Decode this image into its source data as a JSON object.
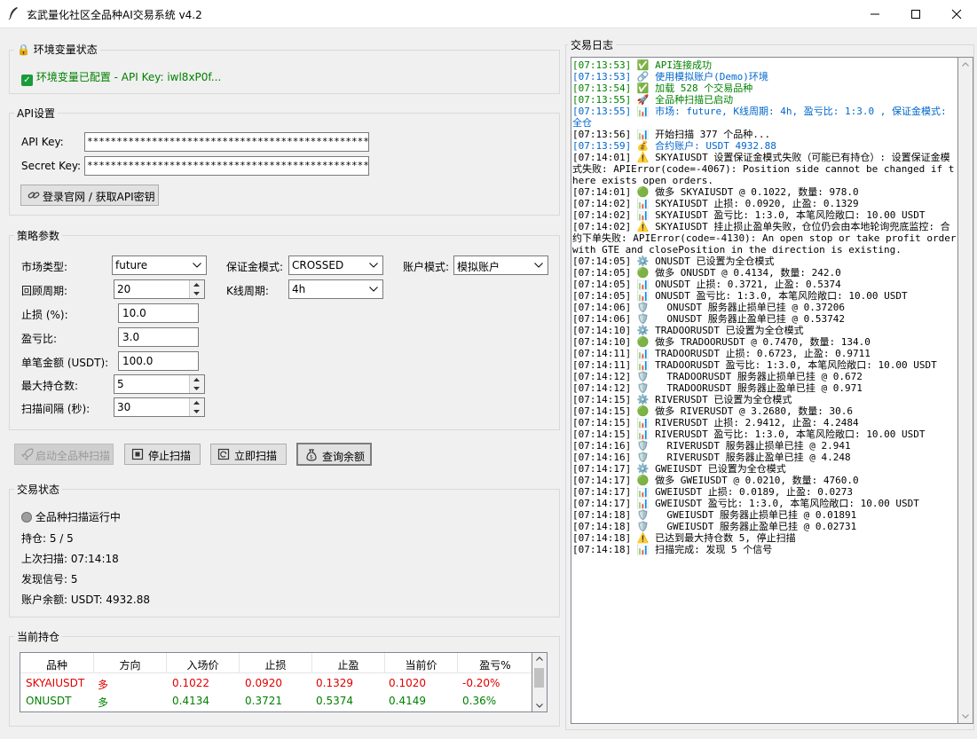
{
  "window": {
    "title": "玄武量化社区全品种AI交易系统 v4.2"
  },
  "env": {
    "group_label": "环境变量状态",
    "status_text": "环境变量已配置 - API Key: iwl8xP0f..."
  },
  "api": {
    "group_label": "API设置",
    "api_key_label": "API Key:",
    "api_key_value": "**************************************************",
    "secret_key_label": "Secret Key:",
    "secret_key_value": "**************************************************",
    "login_button": "登录官网 / 获取API密钥"
  },
  "strategy": {
    "group_label": "策略参数",
    "market_type_label": "市场类型:",
    "market_type_value": "future",
    "margin_mode_label": "保证金模式:",
    "margin_mode_value": "CROSSED",
    "account_mode_label": "账户模式:",
    "account_mode_value": "模拟账户",
    "lookback_label": "回顾周期:",
    "lookback_value": "20",
    "kline_label": "K线周期:",
    "kline_value": "4h",
    "stop_loss_label": "止损 (%):",
    "stop_loss_value": "10.0",
    "rr_label": "盈亏比:",
    "rr_value": "3.0",
    "amount_label": "单笔金额 (USDT):",
    "amount_value": "100.0",
    "max_pos_label": "最大持仓数:",
    "max_pos_value": "5",
    "interval_label": "扫描间隔 (秒):",
    "interval_value": "30"
  },
  "actions": {
    "start": "启动全品种扫描",
    "stop": "停止扫描",
    "scan_now": "立即扫描",
    "balance": "查询余额"
  },
  "status": {
    "group_label": "交易状态",
    "running": "全品种扫描运行中",
    "positions": "持仓: 5 / 5",
    "last_scan": "上次扫描: 07:14:18",
    "signals": "发现信号: 5",
    "balance": "账户余额: USDT: 4932.88"
  },
  "positions_table": {
    "group_label": "当前持仓",
    "headers": [
      "品种",
      "方向",
      "入场价",
      "止损",
      "止盈",
      "当前价",
      "盈亏%"
    ],
    "rows": [
      {
        "cells": [
          "SKYAIUSDT",
          "多",
          "0.1022",
          "0.0920",
          "0.1329",
          "0.1020",
          "-0.20%"
        ],
        "color": "#e00000"
      },
      {
        "cells": [
          "ONUSDT",
          "多",
          "0.4134",
          "0.3721",
          "0.5374",
          "0.4149",
          "0.36%"
        ],
        "color": "#008000"
      }
    ]
  },
  "log": {
    "group_label": "交易日志",
    "lines": [
      {
        "text": "[07:13:53] ✅ API连接成功",
        "style": "gn"
      },
      {
        "text": "[07:13:53] 🔗 使用模拟账户(Demo)环境",
        "style": "bl"
      },
      {
        "text": "[07:13:54] ✅ 加载 528 个交易品种",
        "style": "gn"
      },
      {
        "text": "[07:13:55] 🚀 全品种扫描已启动",
        "style": "gn"
      },
      {
        "text": "[07:13:55] 📊 市场: future, K线周期: 4h, 盈亏比: 1:3.0 , 保证金模式: 全仓",
        "style": "bl"
      },
      {
        "text": "[07:13:56] 📊 开始扫描 377 个品种...",
        "style": ""
      },
      {
        "text": "[07:13:59] 💰 合约账户: USDT 4932.88",
        "style": "bl"
      },
      {
        "text": "[07:14:01] ⚠️ SKYAIUSDT 设置保证金模式失败（可能已有持仓）: 设置保证金模式失败: APIError(code=-4067): Position side cannot be changed if there exists open orders.",
        "style": ""
      },
      {
        "text": "[07:14:01] 🟢 做多 SKYAIUSDT @ 0.1022, 数量: 978.0",
        "style": ""
      },
      {
        "text": "[07:14:02] 📊 SKYAIUSDT 止损: 0.0920, 止盈: 0.1329",
        "style": ""
      },
      {
        "text": "[07:14:02] 📊 SKYAIUSDT 盈亏比: 1:3.0, 本笔风险敞口: 10.00 USDT",
        "style": ""
      },
      {
        "text": "[07:14:02] ⚠️ SKYAIUSDT 挂止损止盈单失败，仓位仍会由本地轮询兜底监控: 合约下单失败: APIError(code=-4130): An open stop or take profit order with GTE and closePosition in the direction is existing.",
        "style": ""
      },
      {
        "text": "[07:14:05] ⚙️ ONUSDT 已设置为全仓模式",
        "style": ""
      },
      {
        "text": "[07:14:05] 🟢 做多 ONUSDT @ 0.4134, 数量: 242.0",
        "style": ""
      },
      {
        "text": "[07:14:05] 📊 ONUSDT 止损: 0.3721, 止盈: 0.5374",
        "style": ""
      },
      {
        "text": "[07:14:05] 📊 ONUSDT 盈亏比: 1:3.0, 本笔风险敞口: 10.00 USDT",
        "style": ""
      },
      {
        "text": "[07:14:06] 🛡️   ONUSDT 服务器止损单已挂 @ 0.37206",
        "style": ""
      },
      {
        "text": "[07:14:06] 🛡️   ONUSDT 服务器止盈单已挂 @ 0.53742",
        "style": ""
      },
      {
        "text": "[07:14:10] ⚙️ TRADOORUSDT 已设置为全仓模式",
        "style": ""
      },
      {
        "text": "[07:14:10] 🟢 做多 TRADOORUSDT @ 0.7470, 数量: 134.0",
        "style": ""
      },
      {
        "text": "[07:14:11] 📊 TRADOORUSDT 止损: 0.6723, 止盈: 0.9711",
        "style": ""
      },
      {
        "text": "[07:14:11] 📊 TRADOORUSDT 盈亏比: 1:3.0, 本笔风险敞口: 10.00 USDT",
        "style": ""
      },
      {
        "text": "[07:14:12] 🛡️   TRADOORUSDT 服务器止损单已挂 @ 0.672",
        "style": ""
      },
      {
        "text": "[07:14:12] 🛡️   TRADOORUSDT 服务器止盈单已挂 @ 0.971",
        "style": ""
      },
      {
        "text": "[07:14:15] ⚙️ RIVERUSDT 已设置为全仓模式",
        "style": ""
      },
      {
        "text": "[07:14:15] 🟢 做多 RIVERUSDT @ 3.2680, 数量: 30.6",
        "style": ""
      },
      {
        "text": "[07:14:15] 📊 RIVERUSDT 止损: 2.9412, 止盈: 4.2484",
        "style": ""
      },
      {
        "text": "[07:14:15] 📊 RIVERUSDT 盈亏比: 1:3.0, 本笔风险敞口: 10.00 USDT",
        "style": ""
      },
      {
        "text": "[07:14:16] 🛡️   RIVERUSDT 服务器止损单已挂 @ 2.941",
        "style": ""
      },
      {
        "text": "[07:14:16] 🛡️   RIVERUSDT 服务器止盈单已挂 @ 4.248",
        "style": ""
      },
      {
        "text": "[07:14:17] ⚙️ GWEIUSDT 已设置为全仓模式",
        "style": ""
      },
      {
        "text": "[07:14:17] 🟢 做多 GWEIUSDT @ 0.0210, 数量: 4760.0",
        "style": ""
      },
      {
        "text": "[07:14:17] 📊 GWEIUSDT 止损: 0.0189, 止盈: 0.0273",
        "style": ""
      },
      {
        "text": "[07:14:17] 📊 GWEIUSDT 盈亏比: 1:3.0, 本笔风险敞口: 10.00 USDT",
        "style": ""
      },
      {
        "text": "[07:14:18] 🛡️   GWEIUSDT 服务器止损单已挂 @ 0.01891",
        "style": ""
      },
      {
        "text": "[07:14:18] 🛡️   GWEIUSDT 服务器止盈单已挂 @ 0.02731",
        "style": ""
      },
      {
        "text": "[07:14:18] ⚠️ 已达到最大持仓数 5, 停止扫描",
        "style": ""
      },
      {
        "text": "[07:14:18] 📊 扫描完成: 发现 5 个信号",
        "style": ""
      }
    ]
  },
  "colors": {
    "green": "#008000",
    "blue": "#0066cc",
    "red": "#e00000"
  }
}
